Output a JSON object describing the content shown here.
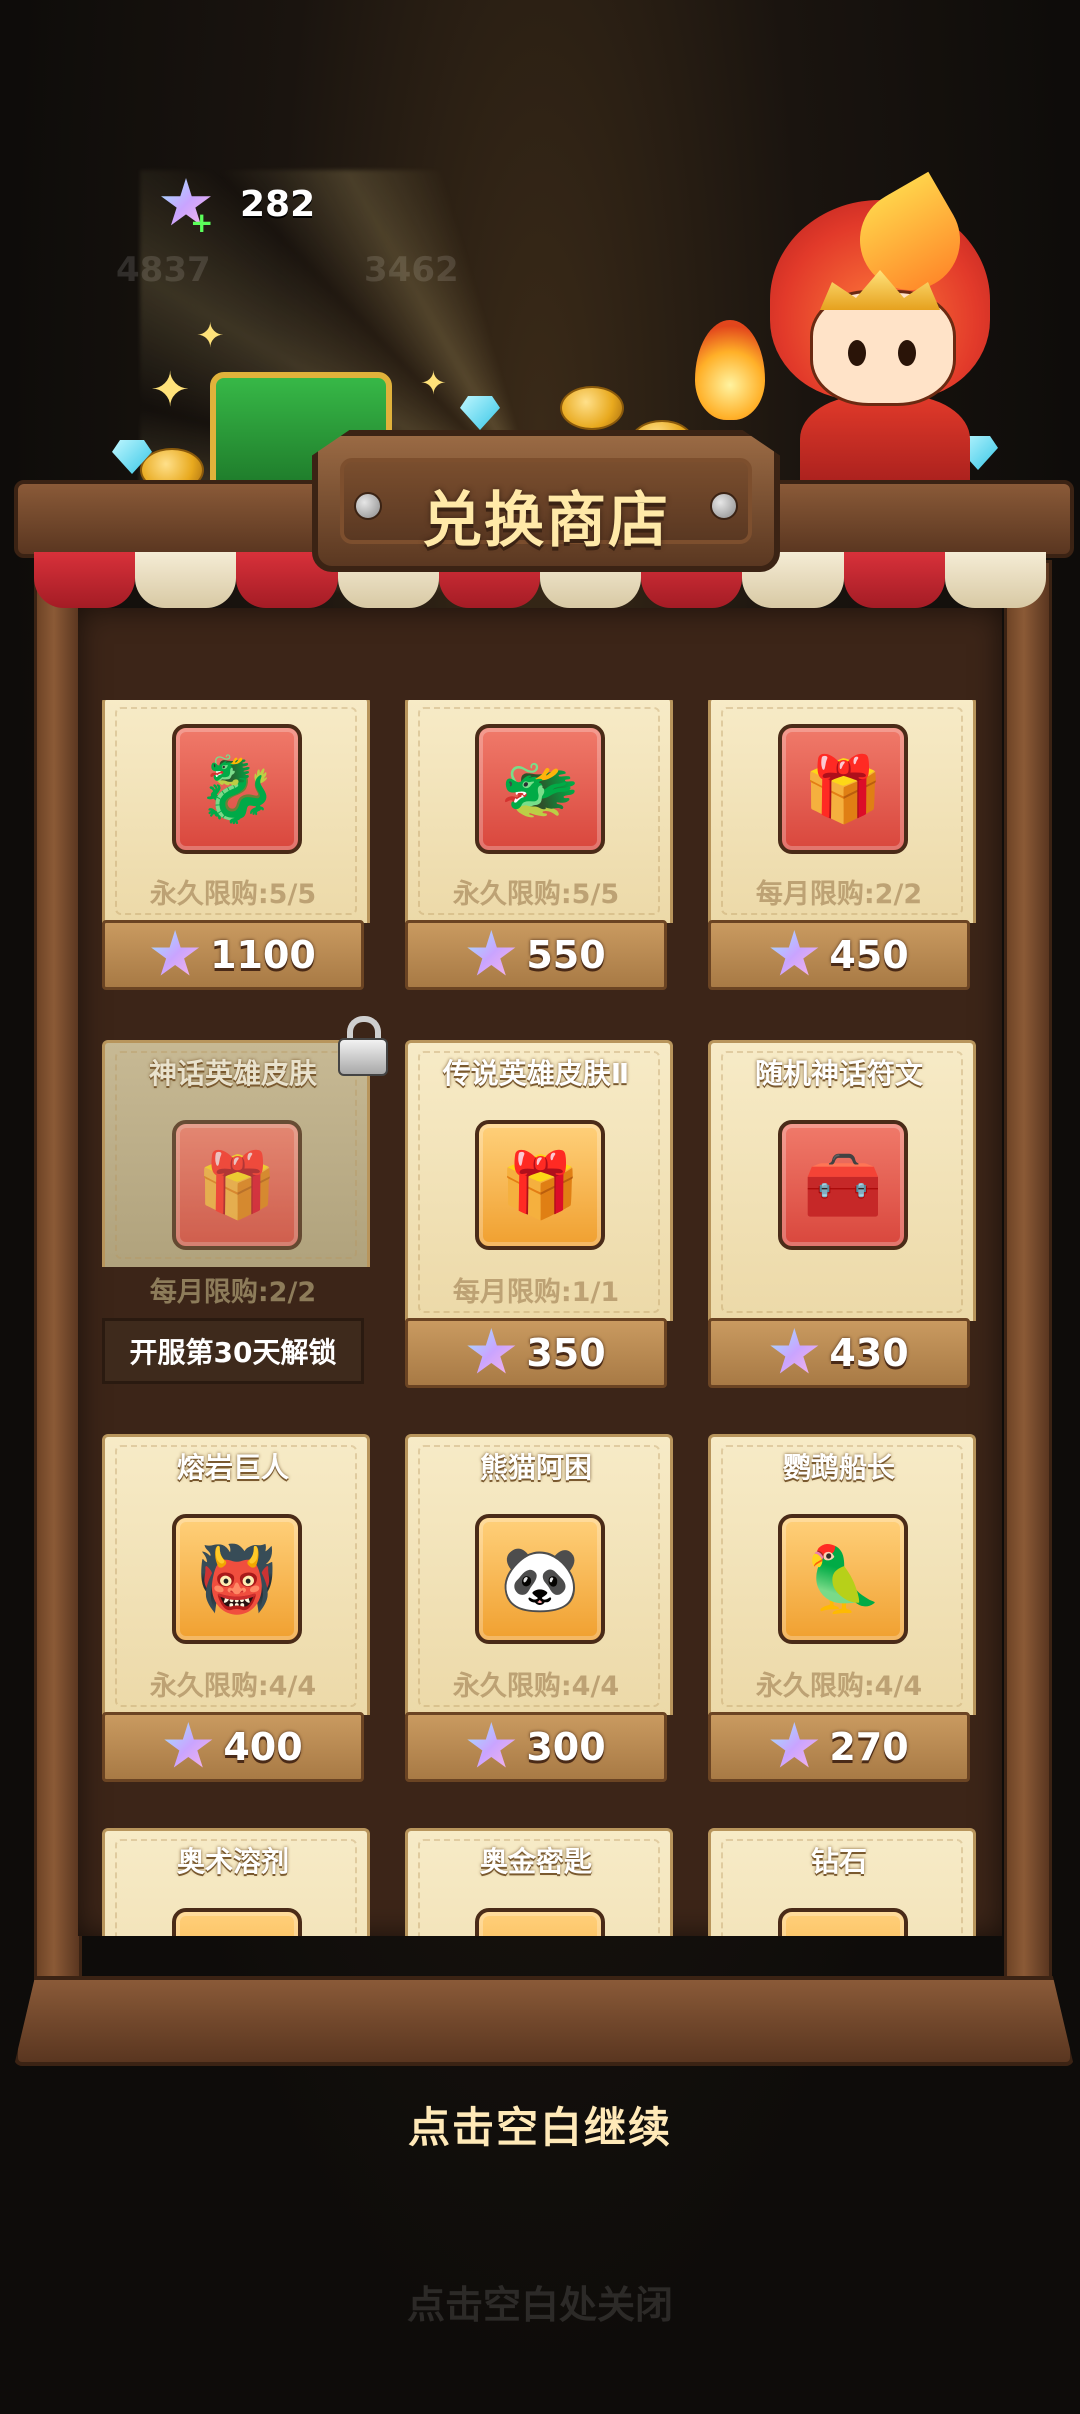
{
  "currency": {
    "icon": "star-gem-icon",
    "value": "282"
  },
  "background": {
    "diamonds": "4837",
    "gold": "3462",
    "hidden_close": "点击空白处关闭"
  },
  "shop": {
    "title": "兑换商店"
  },
  "items": [
    {
      "name": "",
      "icon": "bone-dragon-icon",
      "frame": "red",
      "limit": "永久限购:5/5",
      "price": "1100",
      "locked": false
    },
    {
      "name": "",
      "icon": "shadow-dragon-icon",
      "frame": "red",
      "limit": "永久限购:5/5",
      "price": "550",
      "locked": false
    },
    {
      "name": "",
      "icon": "hero-skin-chest-icon",
      "frame": "red",
      "limit": "每月限购:2/2",
      "price": "450",
      "locked": false
    },
    {
      "name": "神话英雄皮肤",
      "icon": "mythic-skin-chest-icon",
      "frame": "red",
      "limit": "每月限购:2/2",
      "price": "",
      "locked": true,
      "unlock": "开服第30天解锁"
    },
    {
      "name": "传说英雄皮肤Ⅱ",
      "icon": "legend-skin-chest-icon",
      "frame": "orange",
      "limit": "每月限购:1/1",
      "price": "350",
      "locked": false
    },
    {
      "name": "随机神话符文",
      "icon": "mythic-rune-chest-icon",
      "frame": "red",
      "limit": "",
      "price": "430",
      "locked": false
    },
    {
      "name": "熔岩巨人",
      "icon": "lava-giant-icon",
      "frame": "orange",
      "limit": "永久限购:4/4",
      "price": "400",
      "locked": false
    },
    {
      "name": "熊猫阿困",
      "icon": "panda-icon",
      "frame": "orange",
      "limit": "永久限购:4/4",
      "price": "300",
      "locked": false
    },
    {
      "name": "鹦鹉船长",
      "icon": "parrot-captain-icon",
      "frame": "orange",
      "limit": "永久限购:4/4",
      "price": "270",
      "locked": false
    },
    {
      "name": "奥术溶剂",
      "icon": "arcane-potion-icon",
      "frame": "orange",
      "limit": "",
      "price": "",
      "locked": false
    },
    {
      "name": "奥金密匙",
      "icon": "golden-key-icon",
      "frame": "orange",
      "limit": "",
      "price": "",
      "locked": false
    },
    {
      "name": "钻石",
      "icon": "diamond-icon",
      "frame": "orange",
      "limit": "",
      "price": "",
      "locked": false
    }
  ],
  "footer": {
    "continue_label": "点击空白继续"
  }
}
